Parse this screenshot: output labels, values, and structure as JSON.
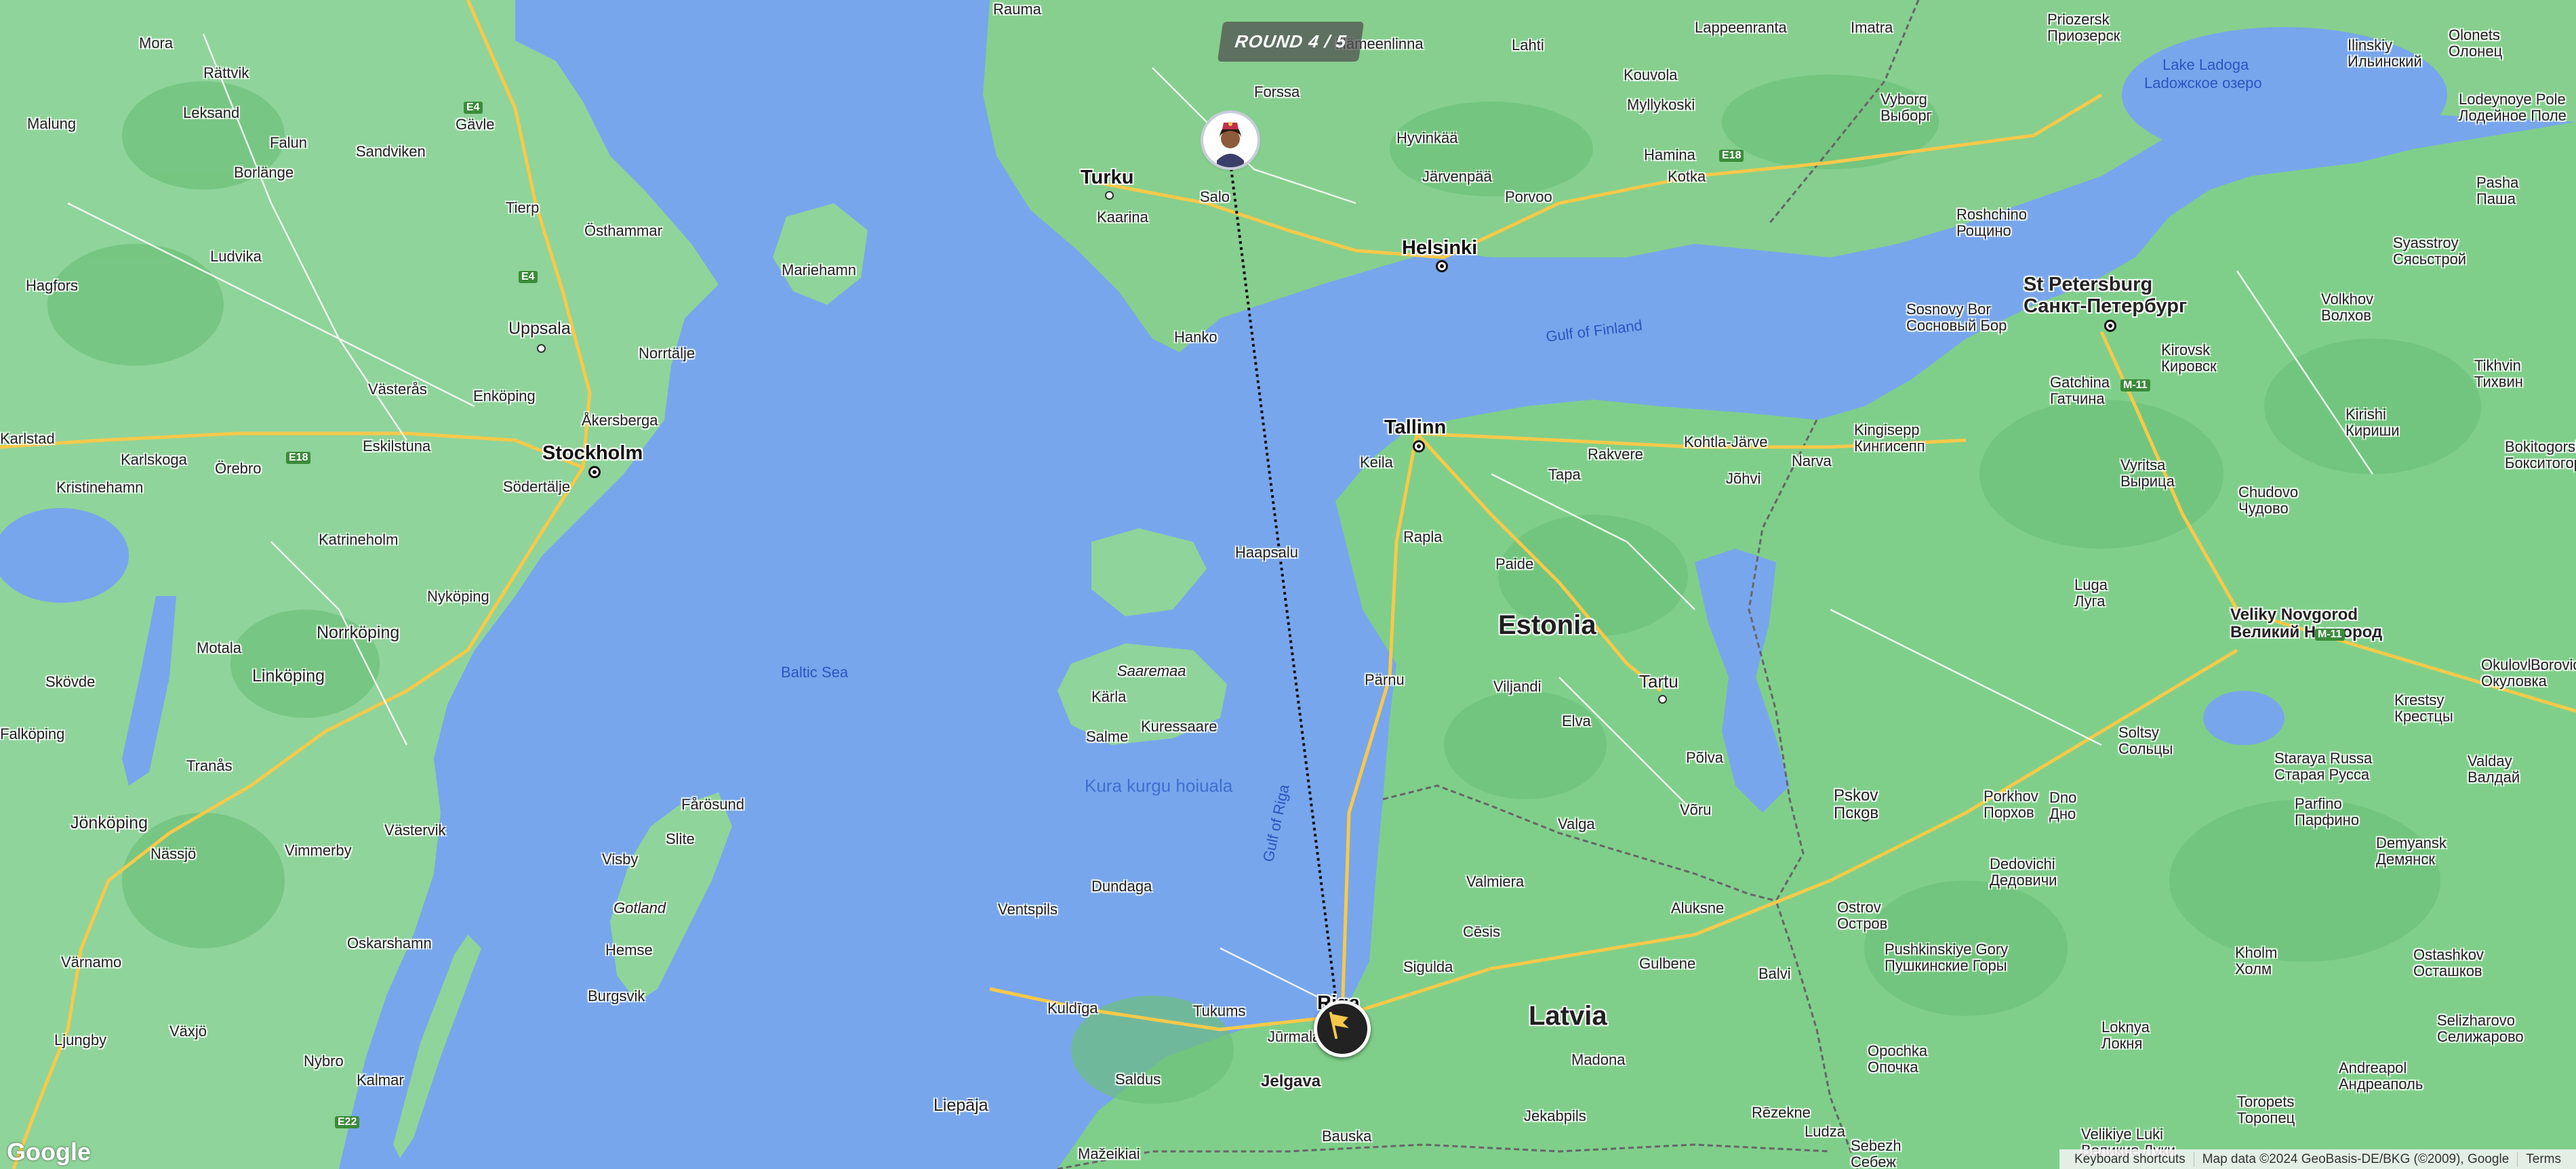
{
  "round": {
    "label": "ROUND 4 / 5"
  },
  "colors": {
    "water": "#78a6ec",
    "land": "#7fcf8a",
    "road_major": "#f7c94a",
    "road_minor": "#ffffff",
    "border": "#666666",
    "path_line": "#111111"
  },
  "markers": {
    "guess": {
      "icon": "avatar-girl-icon"
    },
    "target": {
      "icon": "flag-icon"
    }
  },
  "labels": {
    "countries": [
      "Estonia",
      "Latvia"
    ],
    "capitals": [
      "Stockholm",
      "Helsinki",
      "Tallinn",
      "Riga"
    ],
    "cities": [
      "Turku",
      "Uppsala",
      "Tartu",
      "Pskov",
      "St Petersburg",
      "Veliky Novgorod"
    ],
    "water": [
      "Baltic Sea",
      "Gulf of Finland",
      "Gulf of Riga",
      "Lake Ladoga",
      "Ladoжское озеро",
      "Kura kurgu hoiuala"
    ],
    "islands": [
      "Saaremaa",
      "Gotland"
    ],
    "towns": [
      "Rauma",
      "Hämeenlinna",
      "Lahti",
      "Lappeenranta",
      "Imatra",
      "Forssa",
      "Kouvola",
      "Myllykoski",
      "Hyvinkää",
      "Järvenpää",
      "Porvoo",
      "Kotka",
      "Hamina",
      "Kaarina",
      "Salo",
      "Hanko",
      "Mariehamn",
      "Mora",
      "Rättvik",
      "Malung",
      "Leksand",
      "Falun",
      "Gävle",
      "Borlänge",
      "Sandviken",
      "Ludvika",
      "Tierp",
      "Östhammar",
      "Hagfors",
      "Norrtälje",
      "Västerås",
      "Enköping",
      "Åkersberga",
      "Karlstad",
      "Karlskoga",
      "Eskilstuna",
      "Örebro",
      "Kristinehamn",
      "Södertälje",
      "Katrineholm",
      "Nyköping",
      "Norrköping",
      "Motala",
      "Linköping",
      "Skövde",
      "Falköping",
      "Tranås",
      "Jönköping",
      "Västervik",
      "Vimmerby",
      "Nässjö",
      "Oskarshamn",
      "Värnamo",
      "Växjö",
      "Ljungby",
      "Nybro",
      "Kalmar",
      "Fårösund",
      "Slite",
      "Visby",
      "Hemse",
      "Burgsvik",
      "Kärla",
      "Kuressaare",
      "Salme",
      "Haapsalu",
      "Keila",
      "Rakvere",
      "Kohtla-Järve",
      "Tapa",
      "Jõhvi",
      "Narva",
      "Rapla",
      "Paide",
      "Pärnu",
      "Viljandi",
      "Elva",
      "Põlva",
      "Valga",
      "Võru",
      "Valmiera",
      "Cēsis",
      "Sigulda",
      "Aluksne",
      "Gulbene",
      "Balvi",
      "Madona",
      "Rēzekne",
      "Ludza",
      "Jekabpils",
      "Bauska",
      "Jelgava",
      "Jūrmala",
      "Tukums",
      "Saldus",
      "Kuldīga",
      "Ventspils",
      "Dundaga",
      "Liepāja",
      "Mažeikiai",
      "Sosnovy Bor",
      "Kingisepp",
      "Gatchina",
      "Kirovsk",
      "Volkhov",
      "Tikhvin",
      "Kirishi",
      "Vyritsa",
      "Chudovo",
      "Luga",
      "Soltsy",
      "Porkhov",
      "Dno",
      "Dedovichi",
      "Ostrov",
      "Pushkinskiye Gory",
      "Opochka",
      "Staraya Russa",
      "Parfino",
      "Demyansk",
      "Valday",
      "Okulovka",
      "Krestsy",
      "Borovichi",
      "Kholm",
      "Loknya",
      "Andreapol",
      "Ostashkov",
      "Selizharovo",
      "Toropets",
      "Velikiye Luki",
      "Sebezh",
      "Roshchino",
      "Vyborg",
      "Priozersk",
      "Ilinskiy",
      "Olonets",
      "Lodeynoye Pole",
      "Pasha",
      "Syasstroy",
      "Bokitogorsk"
    ],
    "russian": {
      "Vyborg": "Выборг",
      "Priozersk": "Приозерск",
      "Roshchino": "Рощино",
      "St Petersburg": "Санкт-Петербург",
      "Sosnovy Bor": "Сосновый Бор",
      "Kingisepp": "Кингисепп",
      "Gatchina": "Гатчина",
      "Kirovsk": "Кировск",
      "Volkhov": "Волхов",
      "Syasstroy": "Сясьстрой",
      "Tikhvin": "Тихвин",
      "Kirishi": "Кириши",
      "Vyritsa": "Вырица",
      "Chudovo": "Чудово",
      "Luga": "Луга",
      "Veliky Novgorod": "Великий Новгород",
      "Okulovka": "Окуловка",
      "Krestsy": "Крестцы",
      "Valday": "Валдай",
      "Soltsy": "Сольцы",
      "Staraya Russa": "Старая Русса",
      "Parfino": "Парфино",
      "Demyansk": "Демянск",
      "Pskov": "Псков",
      "Porkhov": "Порхов",
      "Dno": "Дно",
      "Dedovichi": "Дедовичи",
      "Ostrov": "Остров",
      "Pushkinskiye Gory": "Пушкинские Горы",
      "Opochka": "Опочка",
      "Kholm": "Холм",
      "Loknya": "Локня",
      "Andreapol": "Андреаполь",
      "Ostashkov": "Осташков",
      "Selizharovo": "Селижарово",
      "Toropets": "Торопец",
      "Velikiye Luki": "Великие Луки",
      "Sebezh": "Себеж",
      "Lodeynoye Pole": "Лодейное Поле",
      "Pasha": "Паша",
      "Olonets": "Олонец",
      "Ilinskiy": "Ильинский",
      "Bokitogorsk": "Бокситогорск"
    },
    "roads": [
      "E4",
      "E18",
      "M-11",
      "E22"
    ]
  },
  "footer": {
    "logo": "Google",
    "shortcuts": "Keyboard shortcuts",
    "map_data": "Map data ©2024 GeoBasis-DE/BKG (©2009), Google",
    "terms": "Terms"
  }
}
